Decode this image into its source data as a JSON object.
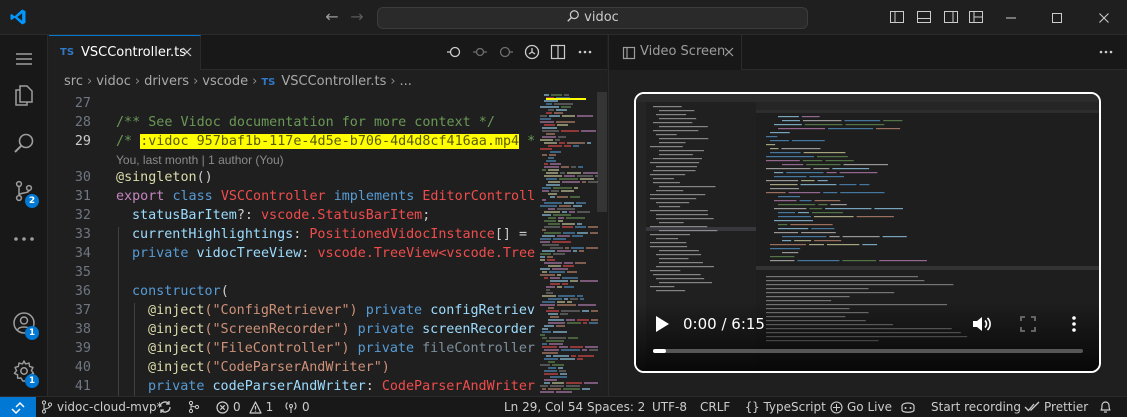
{
  "titlebar": {
    "search_text": "vidoc"
  },
  "activity_bar": {
    "source_control_badge": "2",
    "accounts_badge": "1",
    "manage_badge": "1"
  },
  "editor": {
    "tab": {
      "badge": "TS",
      "label": "VSCController.ts"
    },
    "breadcrumb": [
      "src",
      "vidoc",
      "drivers",
      "vscode",
      "VSCController.ts",
      "..."
    ],
    "breadcrumb_badge": "TS",
    "line_numbers": [
      "27",
      "28",
      "29",
      "",
      "30",
      "31",
      "32",
      "33",
      "34",
      "35",
      "36",
      "37",
      "38",
      "39",
      "40",
      "41"
    ],
    "blame": "You, last month | 1 author (You)",
    "code": {
      "l28": "/** See Vidoc documentation for more context */",
      "l29_open": "/* ",
      "l29_highlight": ":vidoc 957baf1b-117e-4d5e-b706-4d4d8cf416aa.mp4",
      "l29_close": " */",
      "l30_at": "@",
      "l30_dec": "singleton",
      "l30_rest": "()",
      "l31_kw1": "export",
      "l31_kw2": "class",
      "l31_name": "VSCController",
      "l31_kw3": "implements",
      "l31_iface": "EditorController",
      "l32_prop": "statusBarItem",
      "l32_punc": "?: ",
      "l32_type": "vscode.StatusBarItem",
      "l32_end": ";",
      "l33_prop": "currentHighlightings",
      "l33_punc": ": ",
      "l33_type": "PositionedVidocInstance",
      "l33_end": "[] = [];",
      "l34_kw": "private",
      "l34_prop": "vidocTreeView",
      "l34_punc": ": ",
      "l34_type": "vscode.TreeView",
      "l34_gen": "<vscode.TreeIt",
      "l36_fn": "constructor",
      "l36_end": "(",
      "l37_at": "@",
      "l37_dec": "inject",
      "l37_str": "(\"ConfigRetriever\")",
      "l37_kw": "private",
      "l37_prop": "configRetriever",
      "l38_at": "@",
      "l38_dec": "inject",
      "l38_str": "(\"ScreenRecorder\")",
      "l38_kw": "private",
      "l38_prop": "screenRecorder:",
      "l39_at": "@",
      "l39_dec": "inject",
      "l39_str": "(\"FileController\")",
      "l39_kw": "private",
      "l39_prop": "fileController:",
      "l40_at": "@",
      "l40_dec": "inject",
      "l40_str": "(\"CodeParserAndWriter\")",
      "l41_kw": "private",
      "l41_prop": "codeParserAndWriter",
      "l41_punc": ": ",
      "l41_type": "CodeParserAndWriter",
      "l41_end": ","
    }
  },
  "panel": {
    "tab_label": "Video Screen",
    "video": {
      "time": "0:00 / 6:15",
      "progress": 0.03
    }
  },
  "statusbar": {
    "branch": "vidoc-cloud-mvp*",
    "errors": "0",
    "warnings": "1",
    "ports": "0",
    "position": "Ln 29, Col 54",
    "spaces": "Spaces: 2",
    "encoding": "UTF-8",
    "eol": "CRLF",
    "language": "TypeScript",
    "go_live": "Go Live",
    "start_recording": "Start recording",
    "prettier": "Prettier"
  },
  "colors": {
    "accent": "#0078d4",
    "highlight": "#ffff00",
    "background": "#1f1f1f"
  }
}
